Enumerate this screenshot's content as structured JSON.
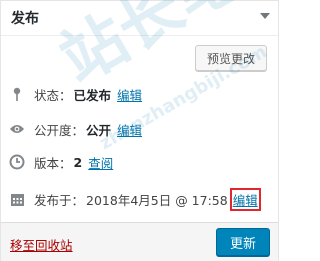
{
  "panel": {
    "title": "发布",
    "preview_button": "预览更改"
  },
  "rows": {
    "status": {
      "label": "状态：",
      "value": "已发布",
      "edit": "编辑"
    },
    "visibility": {
      "label": "公开度：",
      "value": "公开",
      "edit": "编辑"
    },
    "revisions": {
      "label": "版本：",
      "value": "2",
      "link": "查阅"
    },
    "published": {
      "label": "发布于：",
      "value": "2018年4月5日 @ 17:58",
      "edit": "编辑"
    }
  },
  "footer": {
    "trash": "移至回收站",
    "update_button": "更新"
  },
  "watermark": {
    "text": "站长笔记",
    "url": "zhanzhangbiji.com"
  },
  "colors": {
    "link": "#0073aa",
    "primary_button": "#0085ba",
    "trash": "#aa0000",
    "highlight_border": "#e1262c"
  },
  "icons": [
    "chevron-down-icon",
    "pin-icon",
    "eye-icon",
    "clock-icon",
    "calendar-icon"
  ]
}
